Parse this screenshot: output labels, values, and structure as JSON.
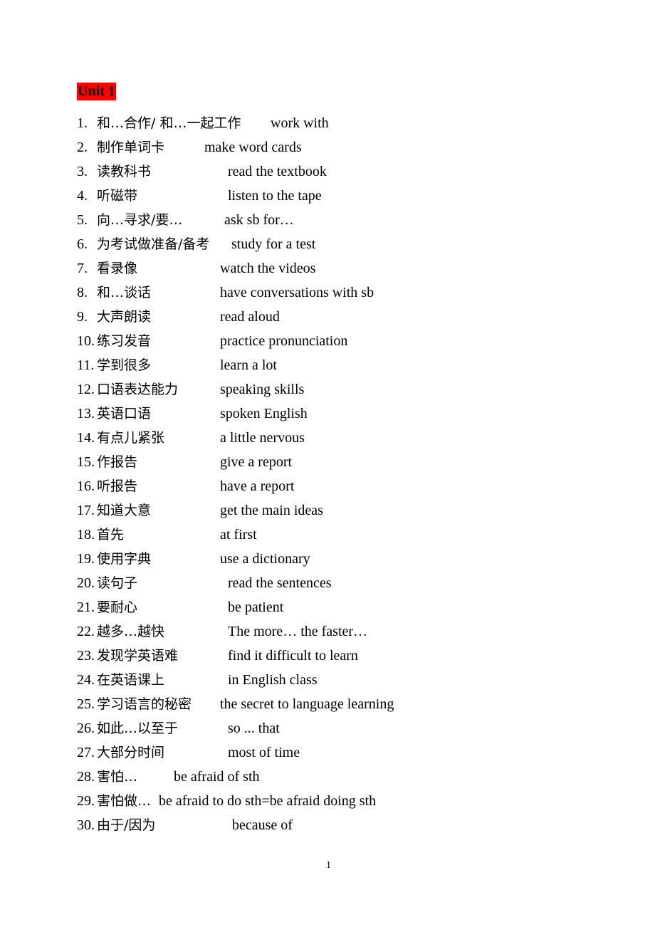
{
  "document": {
    "unit_title": "Unit 1",
    "page_number": "1",
    "items": [
      {
        "num": "1.",
        "zh": "和…合作/  和…一起工作",
        "en": "work with"
      },
      {
        "num": "2.",
        "zh": "制作单词卡",
        "en": "make word cards"
      },
      {
        "num": "3.",
        "zh": "读教科书",
        "en": "read the textbook"
      },
      {
        "num": "4.",
        "zh": "听磁带",
        "en": "listen to the tape"
      },
      {
        "num": "5.",
        "zh": "向…寻求/要…",
        "en": "ask sb for…"
      },
      {
        "num": "6.",
        "zh": "为考试做准备/备考",
        "en": "study for a test"
      },
      {
        "num": "7.",
        "zh": "看录像",
        "en": "watch the videos"
      },
      {
        "num": "8.",
        "zh": "和…谈话",
        "en": "have conversations with sb"
      },
      {
        "num": "9.",
        "zh": "大声朗读",
        "en": "read aloud"
      },
      {
        "num": "10.",
        "zh": "练习发音",
        "en": "practice pronunciation"
      },
      {
        "num": "11.",
        "zh": "学到很多",
        "en": "learn a lot"
      },
      {
        "num": "12.",
        "zh": "口语表达能力",
        "en": "speaking skills"
      },
      {
        "num": "13.",
        "zh": "英语口语",
        "en": "spoken English"
      },
      {
        "num": "14.",
        "zh": "有点儿紧张",
        "en": "a little nervous"
      },
      {
        "num": "15.",
        "zh": "作报告",
        "en": "give a report"
      },
      {
        "num": "16.",
        "zh": "听报告",
        "en": "have a report"
      },
      {
        "num": "17.",
        "zh": "知道大意",
        "en": "get the main ideas"
      },
      {
        "num": "18.",
        "zh": "首先",
        "en": "at first"
      },
      {
        "num": "19.",
        "zh": "使用字典",
        "en": "use a dictionary"
      },
      {
        "num": "20.",
        "zh": "读句子",
        "en": "read the sentences"
      },
      {
        "num": "21.",
        "zh": "要耐心",
        "en": "be patient"
      },
      {
        "num": "22.",
        "zh": "越多…越快",
        "en": "The more… the faster…"
      },
      {
        "num": "23.",
        "zh": "发现学英语难",
        "en": "find it difficult to learn"
      },
      {
        "num": "24.",
        "zh": "在英语课上",
        "en": "in English class"
      },
      {
        "num": "25.",
        "zh": "学习语言的秘密",
        "en": "the secret to language learning"
      },
      {
        "num": "26.",
        "zh": "如此…以至于",
        "en": "so ... that"
      },
      {
        "num": "27.",
        "zh": "大部分时间",
        "en": "most of time"
      },
      {
        "num": "28.",
        "zh": "害怕…",
        "en": "be afraid of sth"
      },
      {
        "num": "29.",
        "zh": "害怕做…",
        "en": "be afraid to do sth=be afraid doing sth"
      },
      {
        "num": "30.",
        "zh": "由于/因为",
        "en": "because of"
      }
    ]
  }
}
